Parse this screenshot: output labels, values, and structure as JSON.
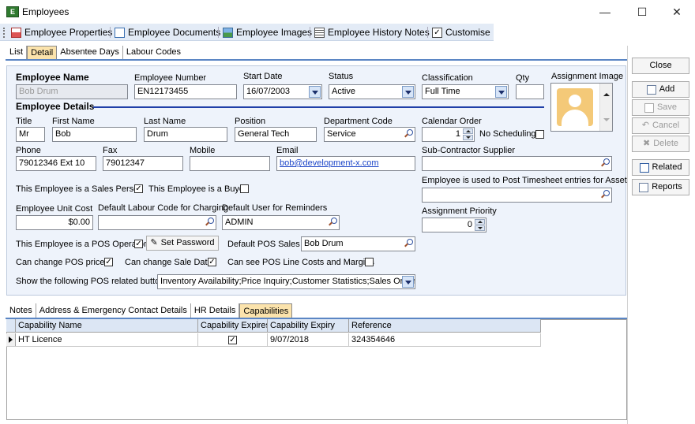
{
  "window": {
    "title": "Employees",
    "min_icon": "minimize-icon",
    "max_icon": "maximize-icon",
    "close_icon": "close-icon"
  },
  "toolbar": {
    "items": [
      {
        "label": "Employee Properties",
        "icon": "properties-icon"
      },
      {
        "label": "Employee Documents",
        "icon": "document-icon"
      },
      {
        "label": "Employee Images",
        "icon": "image-icon"
      },
      {
        "label": "Employee History Notes",
        "icon": "notes-icon"
      },
      {
        "label": "Customise",
        "icon": "checkbox-icon"
      }
    ]
  },
  "top_tabs": [
    "List",
    "Detail",
    "Absentee Days",
    "Labour Codes"
  ],
  "top_tab_active": "Detail",
  "form": {
    "employee_name_label": "Employee Name",
    "employee_name_value": "Bob Drum",
    "employee_number_label": "Employee Number",
    "employee_number_value": "EN12173455",
    "start_date_label": "Start Date",
    "start_date_value": "16/07/2003",
    "status_label": "Status",
    "status_value": "Active",
    "classification_label": "Classification",
    "classification_value": "Full Time",
    "qty_label": "Qty",
    "qty_value": "",
    "assignment_image_label": "Assignment Image",
    "employee_details_label": "Employee Details",
    "title_label": "Title",
    "title_value": "Mr",
    "first_name_label": "First Name",
    "first_name_value": "Bob",
    "last_name_label": "Last Name",
    "last_name_value": "Drum",
    "position_label": "Position",
    "position_value": "General Tech",
    "department_code_label": "Department Code",
    "department_code_value": "Service",
    "calendar_order_label": "Calendar Order",
    "calendar_order_value": "1",
    "no_scheduling_label": "No Scheduling",
    "no_scheduling_checked": false,
    "phone_label": "Phone",
    "phone_value": "79012346 Ext 10",
    "fax_label": "Fax",
    "fax_value": "79012347",
    "mobile_label": "Mobile",
    "mobile_value": "",
    "email_label": "Email",
    "email_value": "bob@development-x.com",
    "sub_contractor_label": "Sub-Contractor Supplier",
    "sub_contractor_value": "",
    "sales_person_label": "This Employee is a Sales Person",
    "sales_person_checked": true,
    "buyer_label": "This Employee is a Buyer",
    "buyer_checked": false,
    "timesheet_asset_label": "Employee is used to Post Timesheet entries for Asset",
    "timesheet_asset_value": "",
    "unit_cost_label": "Employee Unit Cost",
    "unit_cost_value": "$0.00",
    "default_labour_label": "Default Labour Code for Charging",
    "default_labour_value": "",
    "default_user_label": "Default User for Reminders",
    "default_user_value": "ADMIN",
    "assignment_priority_label": "Assignment Priority",
    "assignment_priority_value": "0",
    "pos_operator_label": "This Employee is a POS Operator",
    "pos_operator_checked": true,
    "set_password_label": "Set Password",
    "default_pos_sales_label": "Default POS Sales Person",
    "default_pos_sales_value": "Bob Drum",
    "change_pos_prices_label": "Can change POS prices",
    "change_pos_prices_checked": true,
    "change_sale_date_label": "Can change Sale Date",
    "change_sale_date_checked": true,
    "see_pos_costs_label": "Can see POS Line Costs and Margins",
    "see_pos_costs_checked": false,
    "pos_buttons_label": "Show the following POS related buttons",
    "pos_buttons_value": "Inventory Availability;Price Inquiry;Customer Statistics;Sales Orders;Ima"
  },
  "side_buttons": {
    "close": "Close",
    "add": "Add",
    "save": "Save",
    "cancel": "Cancel",
    "delete": "Delete",
    "related": "Related",
    "reports": "Reports"
  },
  "bottom_tabs": [
    "Notes",
    "Address & Emergency Contact Details",
    "HR Details",
    "Capabilities"
  ],
  "bottom_tab_active": "Capabilities",
  "grid": {
    "columns": [
      "Capability Name",
      "Capability Expires",
      "Capability Expiry",
      "Reference"
    ],
    "rows": [
      {
        "name": "HT Licence",
        "expires": true,
        "expiry": "9/07/2018",
        "reference": "324354646"
      }
    ]
  },
  "colors": {
    "accent": "#5b86c4",
    "active_tab": "#fbe3ac",
    "panel": "#eef3fb",
    "section_line": "#1f3fa8",
    "avatar": "#f4c978"
  }
}
